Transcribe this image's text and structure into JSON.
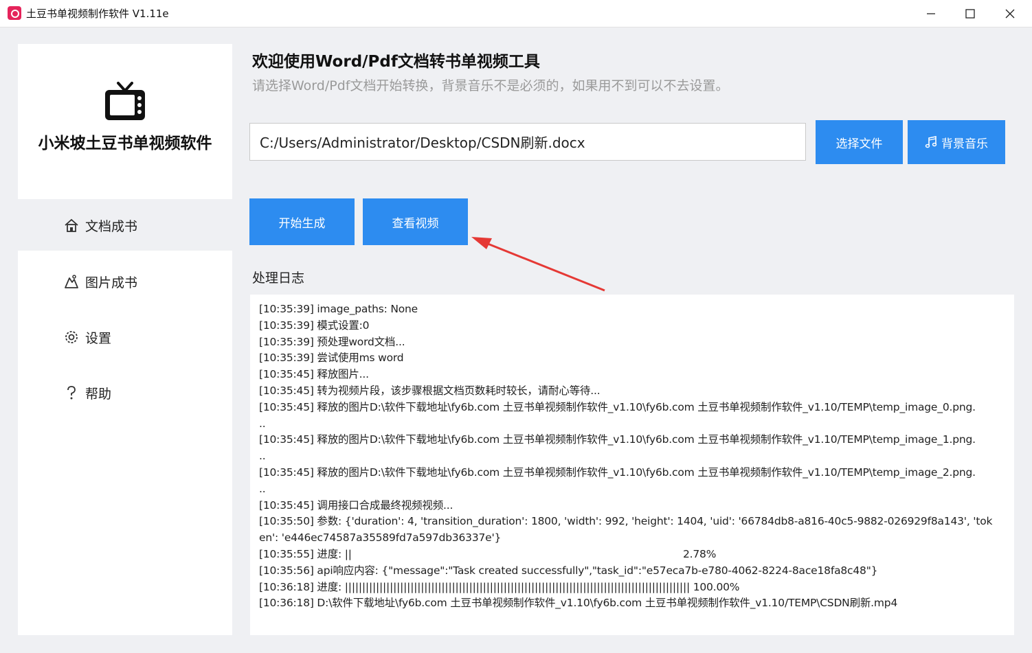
{
  "window": {
    "title": "土豆书单视频制作软件 V1.11e",
    "controls": {
      "minimize": "—",
      "maximize": "☐",
      "close": "✕"
    }
  },
  "sidebar": {
    "logo_text": "小米坡土豆书单视频软件",
    "items": [
      {
        "label": "文档成书",
        "icon": "home-icon"
      },
      {
        "label": "图片成书",
        "icon": "image-icon"
      },
      {
        "label": "设置",
        "icon": "gear-icon"
      },
      {
        "label": "帮助",
        "icon": "question-icon"
      }
    ]
  },
  "main": {
    "title": "欢迎使用Word/Pdf文档转书单视频工具",
    "subtitle": "请选择Word/Pdf文档开始转换，背景音乐不是必须的，如果用不到可以不去设置。",
    "file_path": "C:/Users/Administrator/Desktop/CSDN刷新.docx",
    "select_file_label": "选择文件",
    "bg_music_label": "背景音乐",
    "start_label": "开始生成",
    "view_video_label": "查看视频",
    "log_label": "处理日志"
  },
  "log_lines": [
    "[10:35:39] image_paths: None",
    "[10:35:39] 模式设置:0",
    "[10:35:39] 预处理word文档...",
    "[10:35:39] 尝试使用ms word",
    "[10:35:45] 释放图片...",
    "[10:35:45] 转为视频片段，该步骤根据文档页数耗时较长，请耐心等待...",
    "[10:35:45] 释放的图片D:\\软件下载地址\\fy6b.com 土豆书单视频制作软件_v1.10\\fy6b.com 土豆书单视频制作软件_v1.10/TEMP\\temp_image_0.png.",
    "..",
    "[10:35:45] 释放的图片D:\\软件下载地址\\fy6b.com 土豆书单视频制作软件_v1.10\\fy6b.com 土豆书单视频制作软件_v1.10/TEMP\\temp_image_1.png.",
    "..",
    "[10:35:45] 释放的图片D:\\软件下载地址\\fy6b.com 土豆书单视频制作软件_v1.10\\fy6b.com 土豆书单视频制作软件_v1.10/TEMP\\temp_image_2.png.",
    "..",
    "[10:35:45] 调用接口合成最终视频视频...",
    "[10:35:50] 参数: {'duration': 4, 'transition_duration': 1800, 'width': 992, 'height': 1404, 'uid': '66784db8-a816-40c5-9882-026929f8a143', 'tok",
    "en': 'e446ec74587a35589fd7a597db36337e'}",
    "[10:35:55] 进度: ||                                                                                                      2.78%",
    "[10:35:56] api响应内容: {\"message\":\"Task created successfully\",\"task_id\":\"e57eca7b-e780-4062-8224-8ace18fa8c48\"}",
    "[10:36:18] 进度: |||||||||||||||||||||||||||||||||||||||||||||||||||||||||||||||||||||||||||||||||||||||||||||||||||| 100.00%",
    "[10:36:18] D:\\软件下载地址\\fy6b.com 土豆书单视频制作软件_v1.10\\fy6b.com 土豆书单视频制作软件_v1.10/TEMP\\CSDN刷新.mp4"
  ],
  "colors": {
    "accent": "#2d8cf0",
    "annotation_arrow": "#e53935",
    "app_icon": "#e5245b"
  }
}
